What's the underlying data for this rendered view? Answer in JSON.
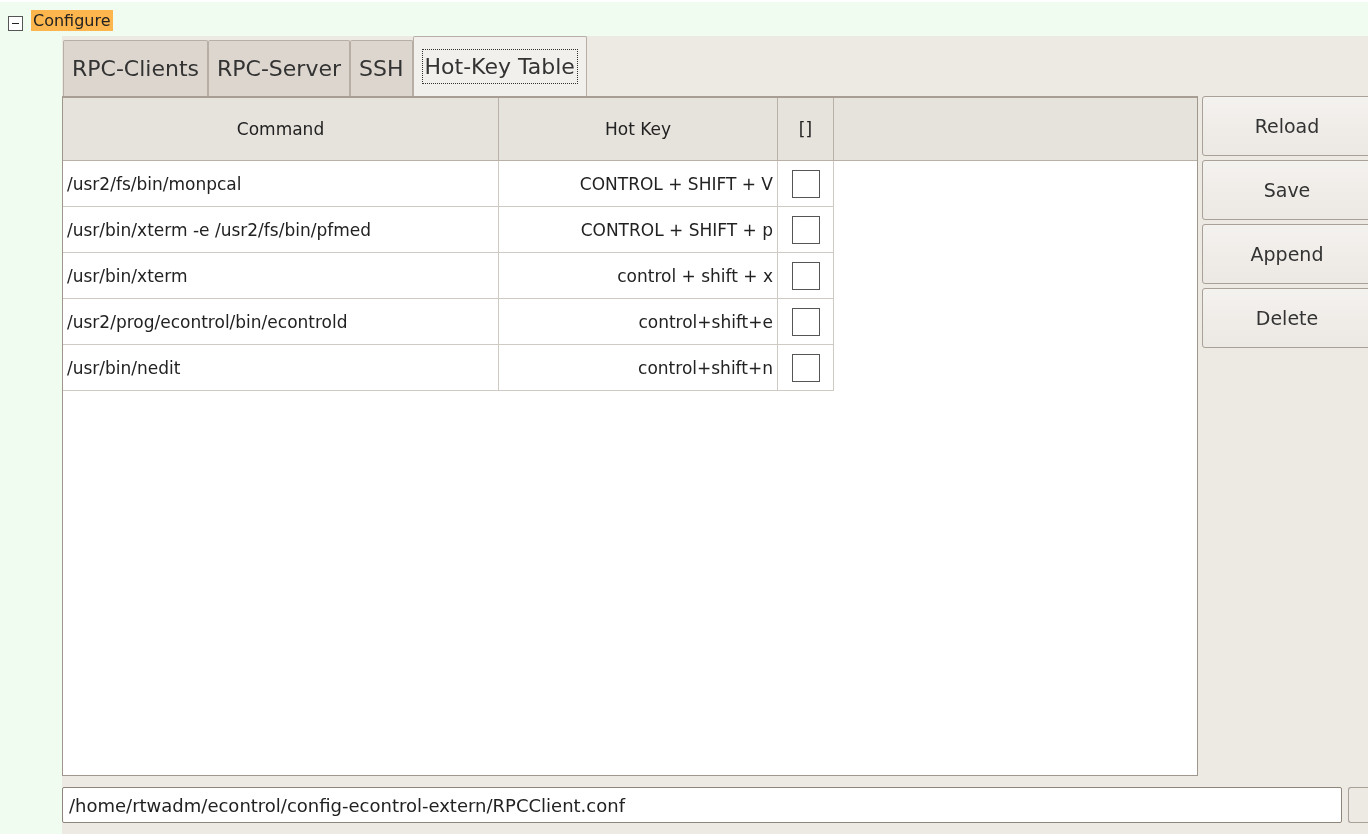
{
  "tree_node": {
    "label": "Configure",
    "expanded": true,
    "selected": true
  },
  "tabs": [
    {
      "label": "RPC-Clients",
      "selected": false
    },
    {
      "label": "RPC-Server",
      "selected": false
    },
    {
      "label": "SSH",
      "selected": false
    },
    {
      "label": "Hot-Key Table",
      "selected": true
    }
  ],
  "table": {
    "columns": [
      "Command",
      "Hot Key",
      "[]"
    ],
    "rows": [
      {
        "command": "/usr2/fs/bin/monpcal",
        "hot_key": "CONTROL + SHIFT + V",
        "checked": false
      },
      {
        "command": "/usr/bin/xterm -e /usr2/fs/bin/pfmed",
        "hot_key": "CONTROL + SHIFT + p",
        "checked": false
      },
      {
        "command": "/usr/bin/xterm",
        "hot_key": "control + shift + x",
        "checked": false
      },
      {
        "command": "/usr2/prog/econtrol/bin/econtrold",
        "hot_key": "control+shift+e",
        "checked": false
      },
      {
        "command": "/usr/bin/nedit",
        "hot_key": "control+shift+n",
        "checked": false
      }
    ]
  },
  "buttons": [
    "Reload",
    "Save",
    "Append",
    "Delete"
  ],
  "path_field": {
    "value": "/home/rtwadm/econtrol/config-econtrol-extern/RPCClient.conf"
  }
}
